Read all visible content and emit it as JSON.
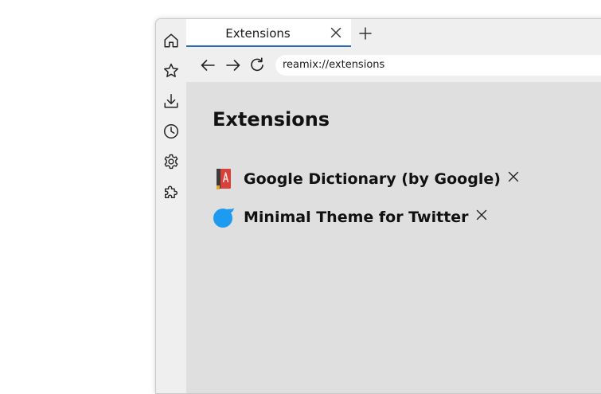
{
  "tab": {
    "title": "Extensions",
    "close_icon": "close-icon",
    "new_tab_icon": "plus-icon"
  },
  "sidebar": {
    "items": [
      {
        "icon": "home-icon"
      },
      {
        "icon": "star-icon"
      },
      {
        "icon": "download-icon"
      },
      {
        "icon": "clock-icon"
      },
      {
        "icon": "gear-icon"
      },
      {
        "icon": "puzzle-icon"
      }
    ]
  },
  "toolbar": {
    "back_icon": "arrow-left-icon",
    "forward_icon": "arrow-right-icon",
    "reload_icon": "reload-icon",
    "address": "reamix://extensions"
  },
  "page": {
    "title": "Extensions",
    "extensions": [
      {
        "name": "Google Dictionary (by Google)",
        "icon": "dictionary-book-icon"
      },
      {
        "name": "Minimal Theme for Twitter",
        "icon": "twitter-bird-icon"
      }
    ]
  },
  "colors": {
    "tab_underline": "#2b6cb8",
    "content_background": "#dfdfdf",
    "chrome_background": "#efefef",
    "twitter_blue": "#1d9bf0",
    "dictionary_red": "#d8413a"
  }
}
